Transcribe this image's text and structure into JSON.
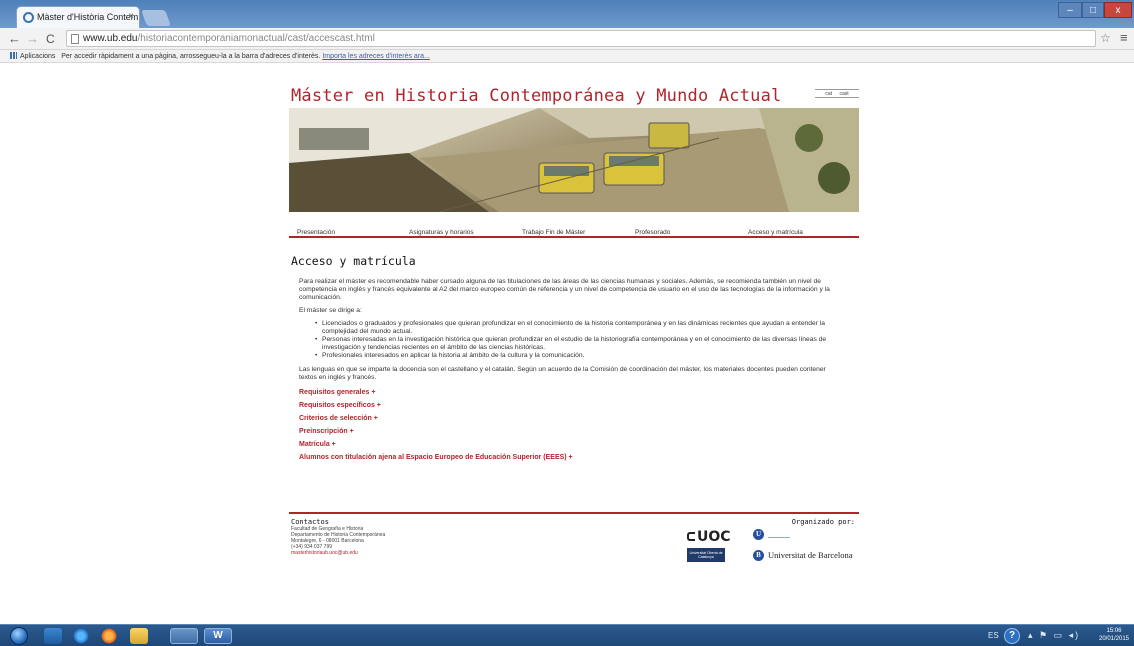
{
  "browser": {
    "tab_title": "Màster d'Història Contem",
    "tab_close": "×",
    "back": "←",
    "forward": "→",
    "reload": "C",
    "url_domain": "www.ub.edu",
    "url_path": "/historiacontemporaniamonactual/cast/accescast.html",
    "star": "☆",
    "menu": "≡",
    "window_min": "–",
    "window_max": "□",
    "window_close": "x"
  },
  "bookmarks": {
    "apps_label": "Aplicacions",
    "hint": "Per accedir ràpidament a una pàgina, arrossegueu-la a la barra d'adreces d'interès.",
    "import_link": "Importa les adreces d'interès ara..."
  },
  "header": {
    "site_title": "Máster en Historia Contemporánea y Mundo Actual",
    "lang_cat": "cat",
    "lang_cast": "cast"
  },
  "nav": {
    "items": [
      {
        "label": "Presentación"
      },
      {
        "label": "Asignaturas y horarios"
      },
      {
        "label": "Trabajo Fin de Máster"
      },
      {
        "label": "Profesorado"
      },
      {
        "label": "Acceso y matrícula"
      }
    ]
  },
  "content": {
    "title": "Acceso y matrícula",
    "intro": "Para realizar el máster es recomendable haber cursado alguna de las titulaciones de las áreas de las ciencias humanas y sociales. Además, se recomienda también un nivel de competencia en inglés y francés equivalente al A2 del marco europeo común de referencia y un nivel de competencia de usuario en el uso de las tecnologías de la información y la comunicación.",
    "directed": "El máster se dirige a:",
    "audience": [
      {
        "text": "Licenciados o graduados y profesionales que quieran profundizar en el conocimiento de la historia contemporánea y en las dinámicas recientes que ayudan a entender la complejidad del mundo actual."
      },
      {
        "text": "Personas interesadas en la investigación histórica que quieran profundizar en el estudio de la historiografía contemporánea y en el conocimiento de las diversas líneas de investigación y tendencias recientes en el ámbito de las ciencias históricas."
      },
      {
        "text": "Profesionales interesados en aplicar la historia al ámbito de la cultura y la comunicación."
      }
    ],
    "languages": "Las lenguas en que se imparte la docencia son el castellano y el catalán. Según un acuerdo de la Comisión de coordinación del máster, los materiales docentes pueden contener textos en inglés y francés.",
    "links": [
      {
        "label": "Requisitos generales +"
      },
      {
        "label": "Requisitos específicos +"
      },
      {
        "label": "Criterios de selección +"
      },
      {
        "label": "Preinscripción +"
      },
      {
        "label": "Matrícula +"
      },
      {
        "label": "Alumnos con titulación ajena al Espacio Europeo de Educación Superior (EEES) +"
      }
    ]
  },
  "footer": {
    "contact_heading": "Contactos",
    "contact_lines": [
      {
        "text": "Facultad de Geografía e Historia"
      },
      {
        "text": "Departamento de Historia Contemporánea"
      },
      {
        "text": "Montalegre, 6 - 08001 Barcelona"
      },
      {
        "text": "(+34) 934 037 799"
      }
    ],
    "email": "masterhistoriaub.uoc@ub.edu",
    "organized_by": "Organizado por:",
    "uoc_word": "UOC",
    "uoc_sub": "Universitat Oberta de Catalunya",
    "ub_letter_top": "U",
    "ub_letter_bottom": "B",
    "ub_name": "Universitat de Barcelona"
  },
  "taskbar": {
    "word_label": "W",
    "lang": "ES",
    "help": "?",
    "tray": "▴ ⚑ ▭ ◂)",
    "time": "15:06",
    "date": "20/01/2015"
  },
  "colors": {
    "accent": "#b0252d",
    "link": "#b0252d",
    "taskbar": "#1e4778"
  }
}
